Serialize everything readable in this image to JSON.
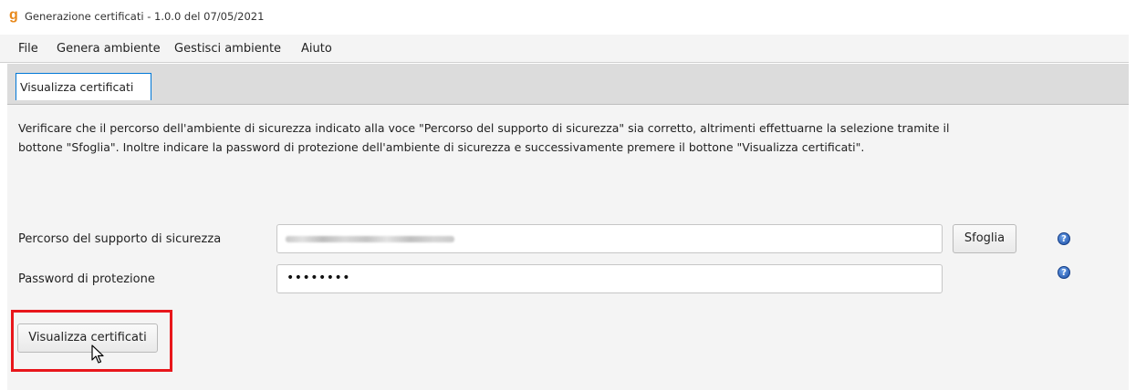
{
  "window": {
    "logo_glyph": "g",
    "title": "Generazione certificati - 1.0.0 del 07/05/2021"
  },
  "menu": {
    "items": [
      "File",
      "Genera ambiente",
      "Gestisci ambiente",
      "Aiuto"
    ]
  },
  "tabs": [
    {
      "label": "Visualizza certificati",
      "selected": true
    }
  ],
  "instructions": {
    "line1": "Verificare che il percorso dell'ambiente di sicurezza indicato alla voce \"Percorso del supporto di sicurezza\" sia corretto, altrimenti effettuarne la selezione tramite il",
    "line2": "bottone \"Sfoglia\". Inoltre indicare la password di protezione dell'ambiente di sicurezza e successivamente premere il bottone \"Visualizza certificati\"."
  },
  "form": {
    "path_label": "Percorso del supporto di sicurezza",
    "browse_label": "Sfoglia",
    "password_label": "Password di protezione",
    "password_value": "••••••••",
    "help_glyph": "?"
  },
  "actions": {
    "view_certificates_label": "Visualizza certificati"
  },
  "colors": {
    "highlight": "#e8161b",
    "tab_focus": "#0078d7",
    "logo": "#e8891c",
    "help_icon": "#1e4fa6"
  }
}
